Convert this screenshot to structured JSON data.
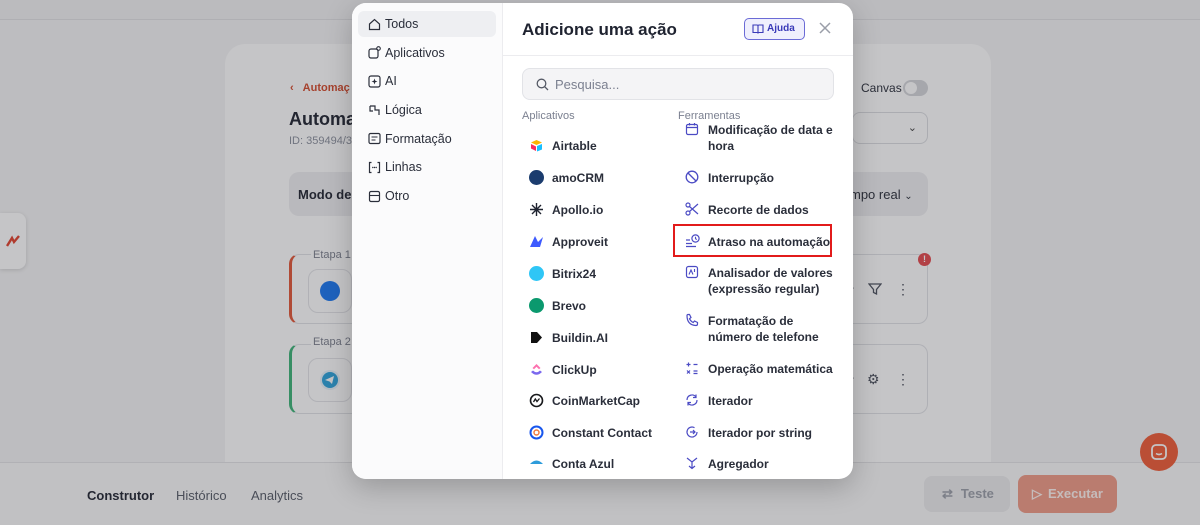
{
  "background": {
    "breadcrumb": "Automaç",
    "title": "Automac",
    "id_text": "ID: 359494/3",
    "mode_label": "Modo de",
    "realtime_label": "mpo real",
    "canvas_label": "Canvas",
    "steps": [
      {
        "label": "Etapa 1 -",
        "right_text": "r"
      },
      {
        "label": "Etapa 2",
        "right_text": "r"
      }
    ],
    "alert": "!",
    "bottom_tabs": [
      "Construtor",
      "Histórico",
      "Analytics"
    ],
    "test_button": "Teste",
    "execute_button": "Executar"
  },
  "modal": {
    "title": "Adicione uma ação",
    "help_label": "Ajuda",
    "search_placeholder": "Pesquisa...",
    "categories": [
      {
        "label": "Todos",
        "icon": "home-icon",
        "active": true
      },
      {
        "label": "Aplicativos",
        "icon": "apps-icon",
        "active": false
      },
      {
        "label": "AI",
        "icon": "ai-sparkle-icon",
        "active": false
      },
      {
        "label": "Lógica",
        "icon": "logic-icon",
        "active": false
      },
      {
        "label": "Formatação",
        "icon": "format-icon",
        "active": false
      },
      {
        "label": "Linhas",
        "icon": "brackets-icon",
        "active": false
      },
      {
        "label": "Otro",
        "icon": "archive-icon",
        "active": false
      }
    ],
    "apps_heading": "Aplicativos",
    "tools_heading": "Ferramentas",
    "apps": [
      {
        "label": "Airtable",
        "color": "#fcb400"
      },
      {
        "label": "amoCRM",
        "color": "#1b3c6e"
      },
      {
        "label": "Apollo.io",
        "color": "#1f2330"
      },
      {
        "label": "Approveit",
        "color": "#3d5afe"
      },
      {
        "label": "Bitrix24",
        "color": "#2fc6f6"
      },
      {
        "label": "Brevo",
        "color": "#0b996e"
      },
      {
        "label": "Buildin.AI",
        "color": "#111111"
      },
      {
        "label": "ClickUp",
        "color": "#7b68ee"
      },
      {
        "label": "CoinMarketCap",
        "color": "#17181b"
      },
      {
        "label": "Constant Contact",
        "color": "#1856ed"
      },
      {
        "label": "Conta Azul",
        "color": "#2d9cdb"
      }
    ],
    "tools": [
      {
        "label": "Modificação de data e hora",
        "icon": "calendar-icon"
      },
      {
        "label": "Interrupção",
        "icon": "stop-icon"
      },
      {
        "label": "Recorte de dados",
        "icon": "scissors-icon"
      },
      {
        "label": "Atraso na automação",
        "icon": "delay-icon"
      },
      {
        "label": "Analisador de valores (expressão regular)",
        "icon": "regex-icon"
      },
      {
        "label": "Formatação de número de telefone",
        "icon": "phone-icon"
      },
      {
        "label": "Operação matemática",
        "icon": "math-icon"
      },
      {
        "label": "Iterador",
        "icon": "iterator-icon"
      },
      {
        "label": "Iterador por string",
        "icon": "string-iterator-icon"
      },
      {
        "label": "Agregador",
        "icon": "aggregator-icon"
      }
    ],
    "accent_color": "#5b5bd6",
    "highlight_color": "#e21b1b"
  }
}
